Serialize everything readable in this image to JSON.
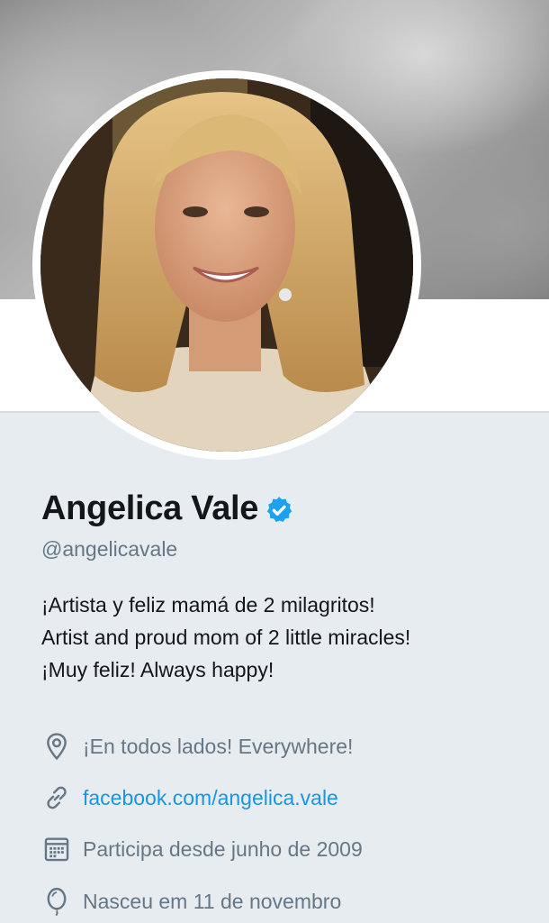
{
  "profile": {
    "display_name": "Angelica Vale",
    "handle": "@angelicavale",
    "verified": true,
    "bio_lines": [
      "¡Artista y feliz mamá de 2 milagritos!",
      "Artist and proud mom of 2 little miracles!",
      "¡Muy feliz! Always happy!"
    ],
    "location": "¡En todos lados! Everywhere!",
    "website": "facebook.com/angelica.vale",
    "joined": "Participa desde junho de 2009",
    "birthday": "Nasceu em 11 de novembro"
  },
  "colors": {
    "verified": "#1da1f2",
    "link": "#1b95e0",
    "secondary_text": "#657786",
    "background": "#e6ecf0"
  },
  "icons": {
    "location": "location-pin-icon",
    "website": "link-icon",
    "joined": "calendar-icon",
    "birthday": "balloon-icon"
  }
}
